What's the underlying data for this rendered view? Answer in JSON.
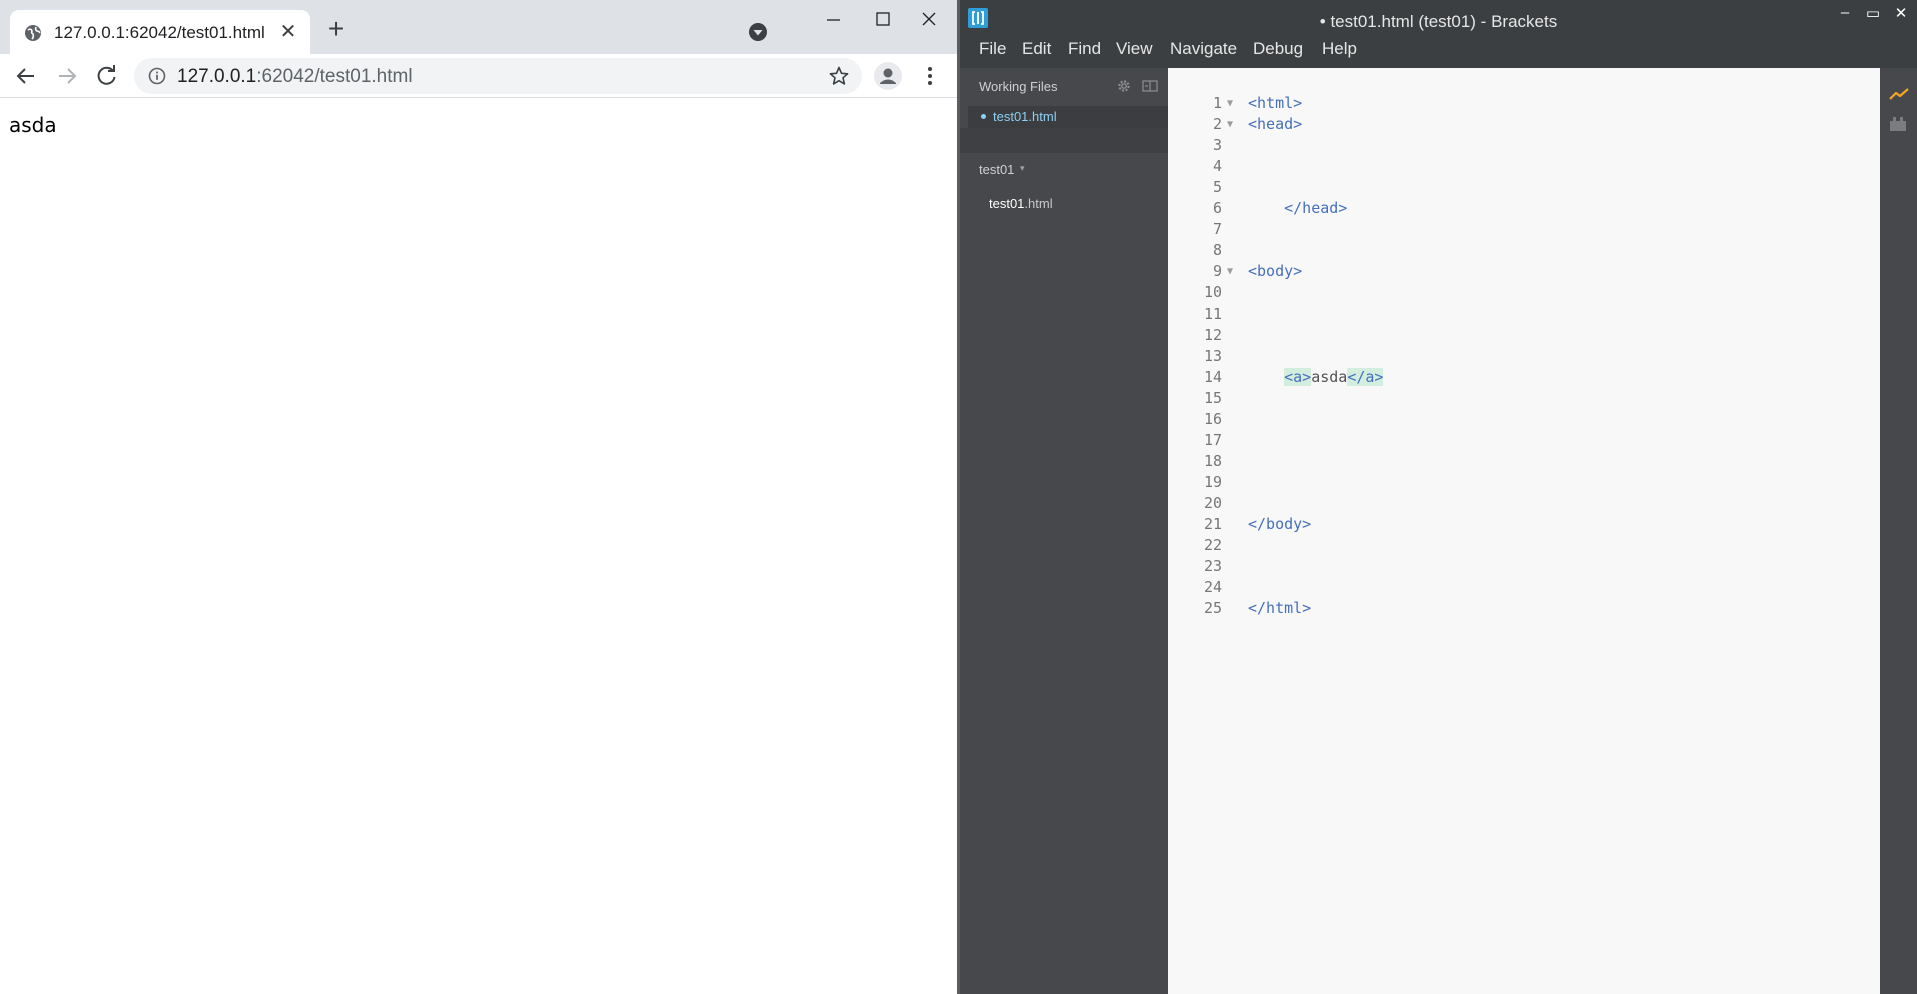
{
  "chrome": {
    "tab": {
      "title": "127.0.0.1:62042/test01.html",
      "close": "✕"
    },
    "new_tab": "+",
    "address": {
      "host": "127.0.0.1",
      "rest": ":62042/test01.html"
    },
    "page": {
      "link_text": "asda"
    },
    "icons": [
      "globe-icon",
      "tab-search-icon",
      "minimize-icon",
      "maximize-icon",
      "close-icon",
      "back-icon",
      "forward-icon",
      "reload-icon",
      "info-icon",
      "star-icon",
      "profile-icon",
      "kebab-menu-icon"
    ]
  },
  "brackets": {
    "window_title": "• test01.html (test01) - Brackets",
    "window_buttons": {
      "minimize": "–",
      "maximize": "▭",
      "close": "✕"
    },
    "menu": [
      "File",
      "Edit",
      "Find",
      "View",
      "Navigate",
      "Debug",
      "Help"
    ],
    "working_files": {
      "header": "Working Files",
      "files": [
        "test01.html"
      ]
    },
    "project": {
      "name": "test01",
      "caret": "▾",
      "files": [
        {
          "base": "test01",
          "ext": ".html"
        }
      ]
    },
    "editor": {
      "lines": [
        {
          "n": "1",
          "fold": "▼",
          "code": "<html>"
        },
        {
          "n": "2",
          "fold": "▼",
          "code": "<head>"
        },
        {
          "n": "3",
          "fold": "",
          "code": ""
        },
        {
          "n": "4",
          "fold": "",
          "code": ""
        },
        {
          "n": "5",
          "fold": "",
          "code": ""
        },
        {
          "n": "6",
          "fold": "",
          "code": "    </head>"
        },
        {
          "n": "7",
          "fold": "",
          "code": ""
        },
        {
          "n": "8",
          "fold": "",
          "code": ""
        },
        {
          "n": "9",
          "fold": "▼",
          "code": "<body>"
        },
        {
          "n": "10",
          "fold": "",
          "code": ""
        },
        {
          "n": "11",
          "fold": "",
          "code": ""
        },
        {
          "n": "12",
          "fold": "",
          "code": ""
        },
        {
          "n": "13",
          "fold": "",
          "code": ""
        },
        {
          "n": "14",
          "fold": "",
          "code": "",
          "indent": "    ",
          "open": "<a>",
          "text": "asda",
          "close": "</a>"
        },
        {
          "n": "15",
          "fold": "",
          "code": ""
        },
        {
          "n": "16",
          "fold": "",
          "code": ""
        },
        {
          "n": "17",
          "fold": "",
          "code": ""
        },
        {
          "n": "18",
          "fold": "",
          "code": ""
        },
        {
          "n": "19",
          "fold": "",
          "code": ""
        },
        {
          "n": "20",
          "fold": "",
          "code": ""
        },
        {
          "n": "21",
          "fold": "",
          "code": "</body>"
        },
        {
          "n": "22",
          "fold": "",
          "code": ""
        },
        {
          "n": "23",
          "fold": "",
          "code": ""
        },
        {
          "n": "24",
          "fold": "",
          "code": ""
        },
        {
          "n": "25",
          "fold": "",
          "code": "</html>"
        }
      ]
    },
    "icons": [
      "brackets-logo-icon",
      "gear-icon",
      "split-view-icon",
      "live-preview-icon",
      "extension-manager-icon"
    ]
  },
  "colors": {
    "chrome_tabstrip": "#dee1e6",
    "brackets_sidebar": "#47484b",
    "brackets_titlebar": "#3c3f41",
    "editor_bg": "#f8f8f8",
    "tag_color": "#446fbd",
    "active_file": "#8bd0f5",
    "tag_match_highlight": "#d3eddf"
  }
}
